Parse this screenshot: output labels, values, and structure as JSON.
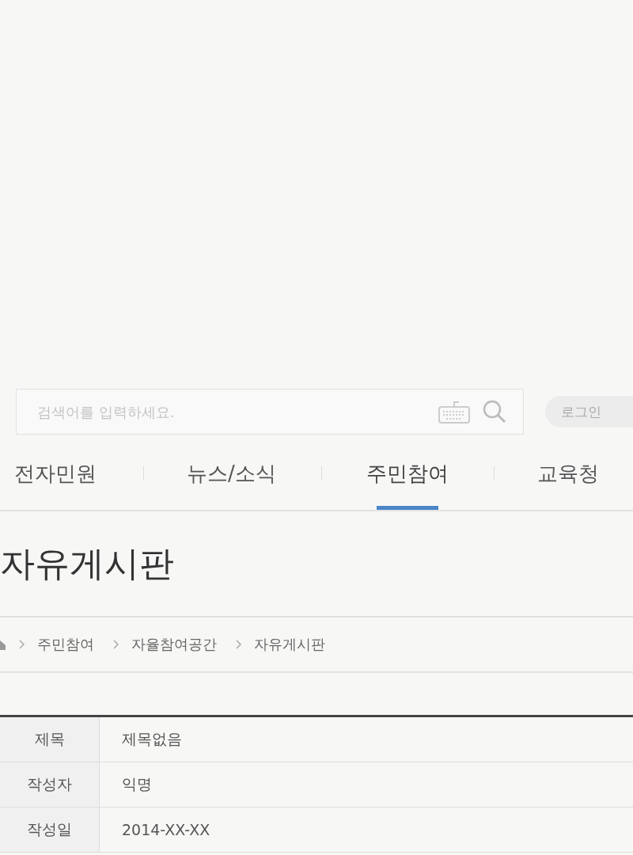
{
  "search": {
    "placeholder": "검색어를 입력하세요."
  },
  "login_button": "로그인",
  "nav": [
    {
      "label": "전자민원",
      "selected": false
    },
    {
      "label": "뉴스/소식",
      "selected": false
    },
    {
      "label": "주민참여",
      "selected": true
    },
    {
      "label": "교육청",
      "selected": false
    }
  ],
  "page_title": "자유게시판",
  "breadcrumb": [
    "주민참여",
    "자율참여공간",
    "자유게시판"
  ],
  "post": [
    {
      "label": "제목",
      "value": "제목없음"
    },
    {
      "label": "작성자",
      "value": "익명"
    },
    {
      "label": "작성일",
      "value": "2014-XX-XX"
    }
  ]
}
